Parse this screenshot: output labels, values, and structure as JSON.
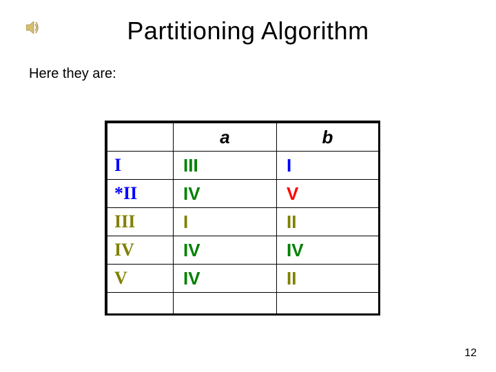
{
  "title": "Partitioning Algorithm",
  "subtitle": "Here they are:",
  "page_number": "12",
  "table": {
    "headers": {
      "col0": "",
      "col1": "a",
      "col2": "b"
    },
    "rows": [
      {
        "label": "I",
        "label_color": "blue",
        "a": "III",
        "a_color": "green",
        "b": "I",
        "b_color": "blue"
      },
      {
        "label": "*II",
        "label_color": "blue",
        "a": "IV",
        "a_color": "green",
        "b": "V",
        "b_color": "red"
      },
      {
        "label": "III",
        "label_color": "olive",
        "a": "I",
        "a_color": "olive",
        "b": "II",
        "b_color": "olive"
      },
      {
        "label": "IV",
        "label_color": "olive",
        "a": "IV",
        "a_color": "green",
        "b": "IV",
        "b_color": "green"
      },
      {
        "label": "V",
        "label_color": "olive",
        "a": "IV",
        "a_color": "green",
        "b": "II",
        "b_color": "olive"
      }
    ]
  },
  "icons": {
    "speaker": "speaker-icon"
  }
}
